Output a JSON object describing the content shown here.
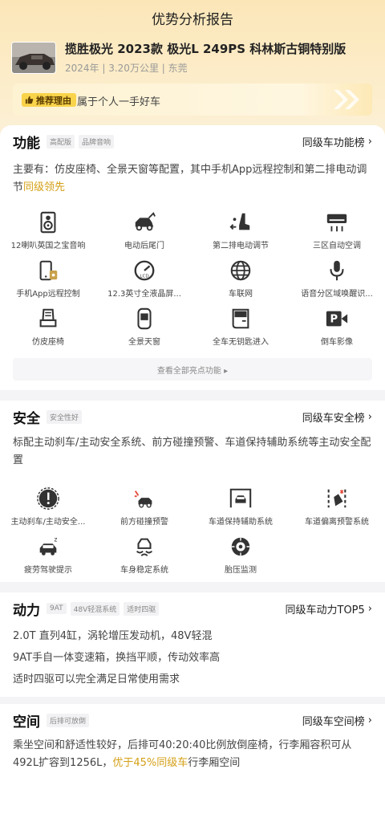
{
  "header": {
    "title": "优势分析报告"
  },
  "car": {
    "name": "揽胜极光 2023款 极光L 249PS 科林斯古铜特别版",
    "year": "2024年",
    "mileage": "3.20万公里",
    "city": "东莞",
    "sep": " | "
  },
  "reason": {
    "tag": "推荐理由",
    "text": "属于个人一手好车"
  },
  "function": {
    "title": "功能",
    "tags": [
      "高配版",
      "品牌音响"
    ],
    "rank": "同级车功能榜",
    "desc_a": "主要有：仿皮座椅、全景天窗等配置，其中手机App远程控制和第二排电动调节",
    "desc_hl": "同级领先",
    "features": [
      {
        "label": "12喇叭英国之宝音响",
        "icon": "speaker-icon"
      },
      {
        "label": "电动后尾门",
        "icon": "tailgate-icon"
      },
      {
        "label": "第二排电动调节",
        "icon": "seat-adjust-icon"
      },
      {
        "label": "三区自动空调",
        "icon": "air-conditioner-icon"
      },
      {
        "label": "手机App远程控制",
        "icon": "phone-remote-icon"
      },
      {
        "label": "12.3英寸全液晶屏...",
        "icon": "lcd-dashboard-icon"
      },
      {
        "label": "车联网",
        "icon": "globe-icon"
      },
      {
        "label": "语音分区域唤醒识...",
        "icon": "microphone-icon"
      },
      {
        "label": "仿皮座椅",
        "icon": "leather-seat-icon"
      },
      {
        "label": "全景天窗",
        "icon": "sunroof-icon"
      },
      {
        "label": "全车无钥匙进入",
        "icon": "car-door-icon"
      },
      {
        "label": "倒车影像",
        "icon": "parking-camera-icon"
      }
    ],
    "more": "查看全部亮点功能 ▸"
  },
  "safety": {
    "title": "安全",
    "tags": [
      "安全性好"
    ],
    "rank": "同级车安全榜",
    "desc": "标配主动刹车/主动安全系统、前方碰撞预警、车道保持辅助系统等主动安全配置",
    "features": [
      {
        "label": "主动刹车/主动安全...",
        "icon": "brake-warning-icon"
      },
      {
        "label": "前方碰撞预警",
        "icon": "collision-warning-icon"
      },
      {
        "label": "车道保持辅助系统",
        "icon": "lane-keep-icon"
      },
      {
        "label": "车道偏离预警系统",
        "icon": "lane-departure-icon"
      },
      {
        "label": "疲劳驾驶提示",
        "icon": "fatigue-icon"
      },
      {
        "label": "车身稳定系统",
        "icon": "stability-icon"
      },
      {
        "label": "胎压监测",
        "icon": "tire-pressure-icon"
      }
    ]
  },
  "power": {
    "title": "动力",
    "tags": [
      "9AT",
      "48V轻混系统",
      "适时四驱"
    ],
    "rank": "同级车动力TOP5",
    "lines": [
      "2.0T 直列4缸，涡轮增压发动机，48V轻混",
      "9AT手自一体变速箱，换挡平顺，传动效率高",
      "适时四驱可以完全满足日常使用需求"
    ]
  },
  "space": {
    "title": "空间",
    "tags": [
      "后排可放倒"
    ],
    "rank": "同级车空间榜",
    "desc_a": "乘坐空间和舒适性较好，后排可40:20:40比例放倒座椅，行李厢容积可从492L扩容到1256L，",
    "desc_hl": "优于45%同级车",
    "desc_b": "行李厢空间"
  },
  "colors": {
    "accent": "#f9d34a",
    "highlight": "#d4a017"
  }
}
